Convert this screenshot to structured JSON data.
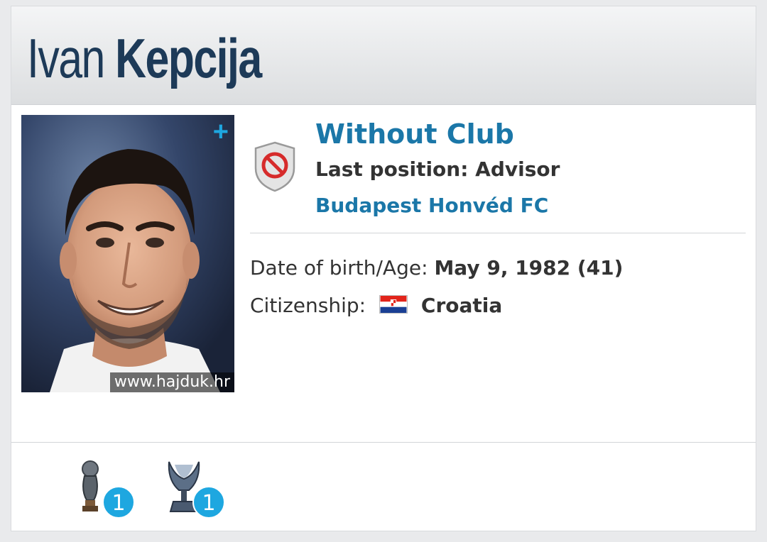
{
  "player": {
    "first_name": "Ivan",
    "last_name": "Kepcija"
  },
  "photo": {
    "credit": "www.hajduk.hr",
    "plus_label": "+"
  },
  "club": {
    "current": "Without Club",
    "last_position": "Last position: Advisor",
    "last_club": "Budapest Honvéd FC"
  },
  "info": {
    "dob_label": "Date of birth/Age:",
    "dob_value": "May 9, 1982 (41)",
    "citizenship_label": "Citizenship:",
    "citizenship_value": "Croatia"
  },
  "trophies": [
    {
      "icon": "world-trophy-icon",
      "count": "1"
    },
    {
      "icon": "cup-trophy-icon",
      "count": "1"
    }
  ],
  "colors": {
    "accent": "#1ea7e0",
    "link": "#1b77a8",
    "title": "#1d3a58"
  }
}
